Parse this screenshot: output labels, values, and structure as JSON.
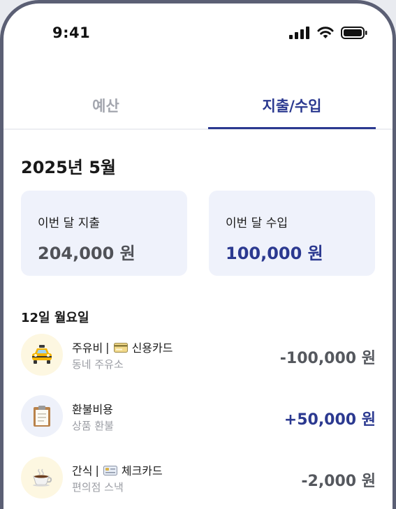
{
  "status_bar": {
    "time": "9:41"
  },
  "tabs": [
    {
      "label": "예산",
      "active": false
    },
    {
      "label": "지출/수입",
      "active": true
    }
  ],
  "month_title": "2025년 5월",
  "summary": {
    "expense": {
      "label": "이번 달 지출",
      "value": "204,000 원"
    },
    "income": {
      "label": "이번 달 수입",
      "value": "100,000 원"
    }
  },
  "day_header": "12일 월요일",
  "transactions": [
    {
      "category": "주유비",
      "separator": "|",
      "card_icon": "credit-card-icon",
      "card": "신용카드",
      "memo": "동네 주유소",
      "amount": "-100,000 원",
      "type": "expense",
      "icon": "taxi-icon",
      "icon_bg": "#fdf7e1"
    },
    {
      "category": "환불비용",
      "memo": "상품 환불",
      "amount": "+50,000 원",
      "type": "income",
      "icon": "clipboard-icon",
      "icon_bg": "#eef1fa"
    },
    {
      "category": "간식",
      "separator": "|",
      "card_icon": "check-card-icon",
      "card": "체크카드",
      "memo": "편의점 스낵",
      "amount": "-2,000 원",
      "type": "expense",
      "icon": "coffee-cup-icon",
      "icon_bg": "#fdf7e1"
    }
  ],
  "colors": {
    "accent": "#2b3990",
    "card_bg": "#eff2fb",
    "muted": "#a3a6ae",
    "frame": "#5b5f74"
  }
}
